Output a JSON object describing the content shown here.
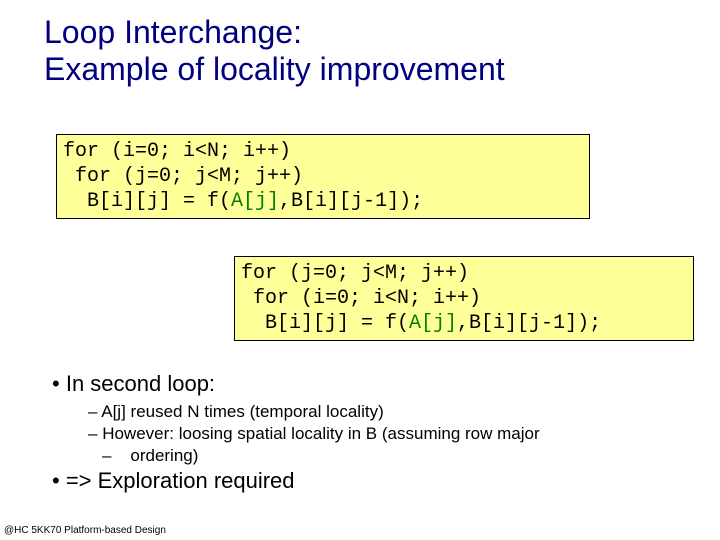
{
  "title_line1": "Loop Interchange:",
  "title_line2": "Example of locality improvement",
  "code1": {
    "l1": "for (i=0; i<N; i++)",
    "l2": " for (j=0; j<M; j++)",
    "l3a": "  B[i][j] = f(",
    "l3b": "A[j]",
    "l3c": ",B[i][j-1]);"
  },
  "code2": {
    "l1": "for (j=0; j<M; j++)",
    "l2": " for (i=0; i<N; i++)",
    "l3a": "  B[i][j] = f(",
    "l3b": "A[j]",
    "l3c": ",B[i][j-1]);"
  },
  "bullets": {
    "b1": "In second loop:",
    "s1": "A[j] reused N times (temporal locality)",
    "s2": "However: loosing spatial locality in B (assuming row major",
    "s3": "ordering)",
    "b2": "=> Exploration required"
  },
  "footer": "@HC 5KK70 Platform-based Design"
}
